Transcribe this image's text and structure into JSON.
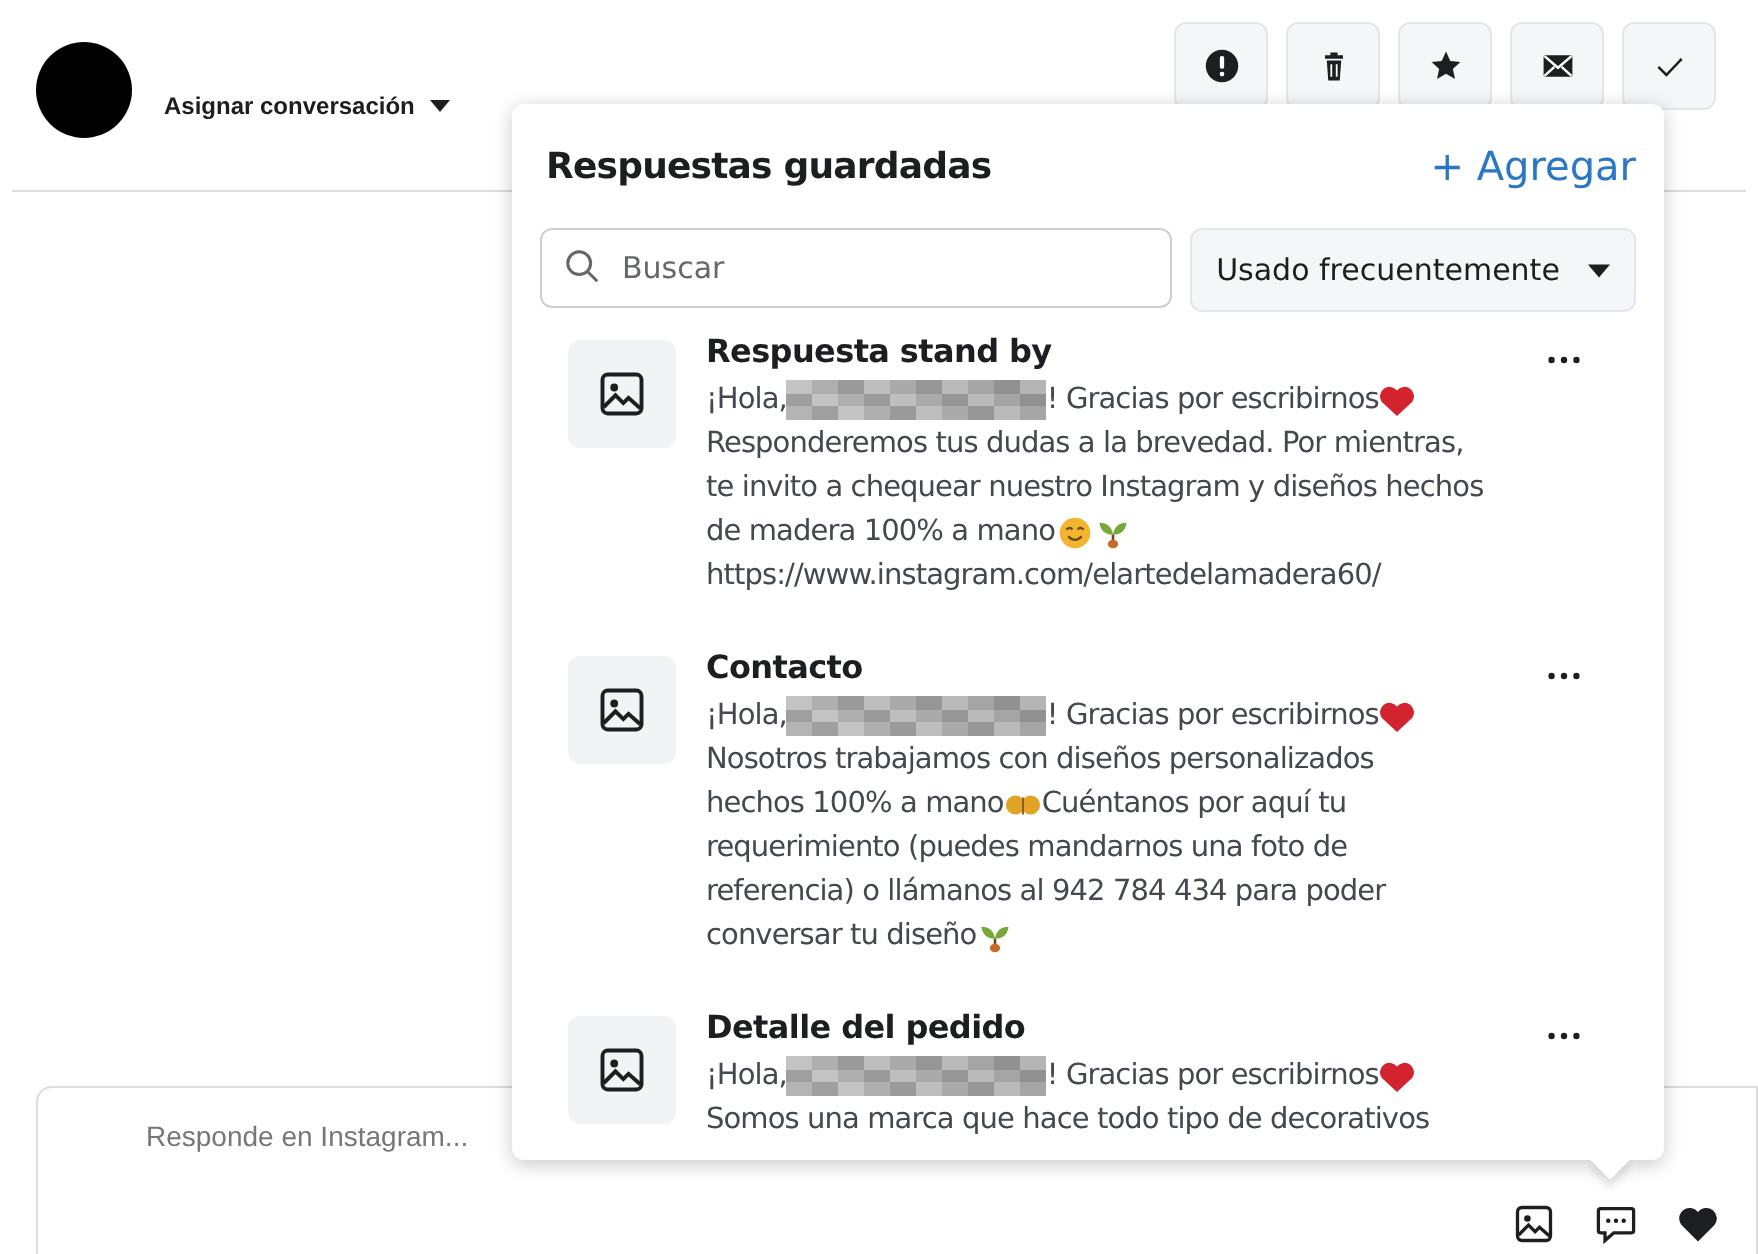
{
  "header": {
    "assign_label": "Asignar conversación",
    "actions": [
      {
        "kind": "alert"
      },
      {
        "kind": "trash"
      },
      {
        "kind": "star"
      },
      {
        "kind": "mail"
      },
      {
        "kind": "check"
      }
    ]
  },
  "saved_replies": {
    "title": "Respuestas guardadas",
    "add_label": "+ Agregar",
    "search": {
      "placeholder": "Buscar"
    },
    "sort": {
      "value": "Usado frecuentemente"
    },
    "items": [
      {
        "title": "Respuesta stand by",
        "lines": [
          [
            {
              "kind": "text",
              "text": "¡Hola, "
            },
            {
              "kind": "redacted"
            },
            {
              "kind": "text",
              "text": " ! Gracias por escribirnos"
            },
            {
              "kind": "heart"
            }
          ],
          [
            {
              "kind": "text",
              "text": "Responderemos tus dudas a la brevedad. Por mientras,"
            }
          ],
          [
            {
              "kind": "text",
              "text": "te invito a chequear nuestro Instagram y diseños hechos"
            }
          ],
          [
            {
              "kind": "text",
              "text": "de madera 100% a mano "
            },
            {
              "kind": "smile"
            },
            {
              "kind": "sprout"
            }
          ],
          [
            {
              "kind": "text",
              "text": "https://www.instagram.com/elartedelamadera60/"
            }
          ]
        ]
      },
      {
        "title": "Contacto",
        "lines": [
          [
            {
              "kind": "text",
              "text": "¡Hola, "
            },
            {
              "kind": "redacted"
            },
            {
              "kind": "text",
              "text": " ! Gracias por escribirnos"
            },
            {
              "kind": "heart"
            }
          ],
          [
            {
              "kind": "text",
              "text": "Nosotros trabajamos con diseños personalizados"
            }
          ],
          [
            {
              "kind": "text",
              "text": "hechos 100% a mano"
            },
            {
              "kind": "hands"
            },
            {
              "kind": "text",
              "text": " Cuéntanos por aquí tu"
            }
          ],
          [
            {
              "kind": "text",
              "text": "requerimiento (puedes mandarnos una foto de"
            }
          ],
          [
            {
              "kind": "text",
              "text": "referencia) o llámanos al 942 784 434 para poder"
            }
          ],
          [
            {
              "kind": "text",
              "text": "conversar tu diseño "
            },
            {
              "kind": "sprout"
            }
          ]
        ]
      },
      {
        "title": "Detalle del pedido",
        "lines": [
          [
            {
              "kind": "text",
              "text": "¡Hola, "
            },
            {
              "kind": "redacted"
            },
            {
              "kind": "text",
              "text": " ! Gracias por escribirnos"
            },
            {
              "kind": "heart"
            }
          ],
          [
            {
              "kind": "text",
              "text": "Somos una marca que hace todo tipo de decorativos"
            }
          ]
        ]
      }
    ]
  },
  "composer": {
    "placeholder": "Responde en Instagram...",
    "tools": [
      {
        "kind": "image"
      },
      {
        "kind": "saved-replies"
      },
      {
        "kind": "like"
      }
    ]
  }
}
